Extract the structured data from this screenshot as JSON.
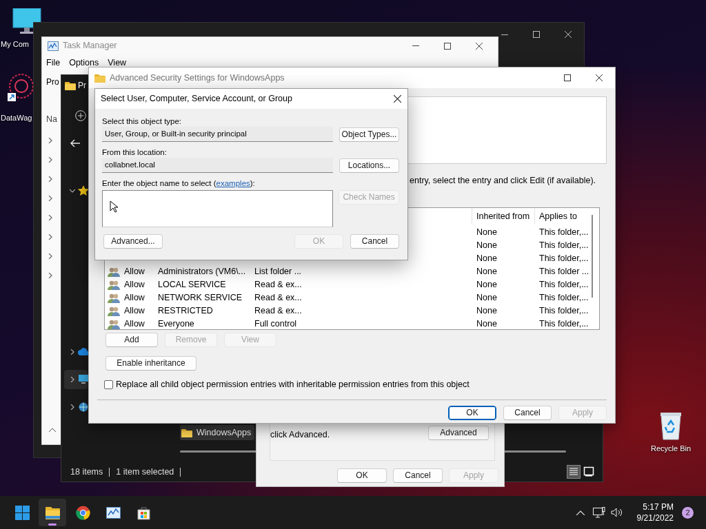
{
  "desktop_icons": [
    {
      "kind": "monitor",
      "label": "My Com"
    },
    {
      "kind": "app",
      "label": "DataWag"
    },
    {
      "kind": "bin",
      "label": "Recycle Bin"
    }
  ],
  "task_manager": {
    "title": "Task Manager",
    "menu": [
      "File",
      "Options",
      "View"
    ],
    "tab": "Pro",
    "column": "Na",
    "rows": [
      {
        "expanded": false
      },
      {
        "expanded": false
      },
      {
        "expanded": false
      },
      {
        "expanded": false
      },
      {
        "expanded": false
      },
      {
        "expanded": false
      },
      {
        "expanded": false
      },
      {
        "expanded": false
      }
    ]
  },
  "explorer": {
    "title": "Pr",
    "nav": [
      {
        "kind": "star",
        "expanded": true,
        "selected": false
      },
      {
        "kind": "cloud",
        "expanded": false,
        "selected": false
      },
      {
        "kind": "pc",
        "expanded": false,
        "selected": true
      },
      {
        "kind": "network",
        "expanded": false,
        "selected": false
      }
    ],
    "files": [
      {
        "label": "WindowsApps",
        "selected": true
      }
    ],
    "status": [
      "18 items",
      "1 item selected"
    ]
  },
  "properties": {
    "note": "click Advanced.",
    "advanced_button": "Advanced",
    "buttons": [
      {
        "label": "OK",
        "disabled": false
      },
      {
        "label": "Cancel",
        "disabled": false
      },
      {
        "label": "Apply",
        "disabled": true
      }
    ]
  },
  "advanced_security": {
    "title": "Advanced Security Settings for WindowsApps",
    "instruction": "entry, select the entry and click Edit (if available).",
    "columns": [
      "Inherited from",
      "Applies to"
    ],
    "rows": [
      {
        "inherited": "None",
        "applies": "This folder,..."
      },
      {
        "inherited": "None",
        "applies": "This folder,..."
      },
      {
        "inherited": "None",
        "applies": "This folder,..."
      },
      {
        "type": "Allow",
        "principal": "Administrators (VM6\\...",
        "access": "List folder ...",
        "inherited": "None",
        "applies": "This folder ..."
      },
      {
        "type": "Allow",
        "principal": "LOCAL SERVICE",
        "access": "Read & ex...",
        "inherited": "None",
        "applies": "This folder,..."
      },
      {
        "type": "Allow",
        "principal": "NETWORK SERVICE",
        "access": "Read & ex...",
        "inherited": "None",
        "applies": "This folder,..."
      },
      {
        "type": "Allow",
        "principal": "RESTRICTED",
        "access": "Read & ex...",
        "inherited": "None",
        "applies": "This folder,..."
      },
      {
        "type": "Allow",
        "principal": "Everyone",
        "access": "Full control",
        "inherited": "None",
        "applies": "This folder,..."
      }
    ],
    "actions": [
      {
        "label": "Add",
        "disabled": false
      },
      {
        "label": "Remove",
        "disabled": true
      },
      {
        "label": "View",
        "disabled": true
      }
    ],
    "enable_inheritance": "Enable inheritance",
    "replace_checkbox": {
      "label": "Replace all child object permission entries with inheritable permission entries from this object",
      "checked": false
    },
    "buttons": [
      {
        "label": "OK",
        "disabled": false,
        "default": true
      },
      {
        "label": "Cancel",
        "disabled": false,
        "default": false
      },
      {
        "label": "Apply",
        "disabled": true,
        "default": false
      }
    ]
  },
  "select_dialog": {
    "title": "Select User, Computer, Service Account, or Group",
    "object_type_label": "Select this object type:",
    "object_type": "User, Group, or Built-in security principal",
    "object_types_button": "Object Types...",
    "location_label": "From this location:",
    "location": "collabnet.local",
    "locations_button": "Locations...",
    "name_label": "Enter the object name to select (",
    "examples_link": "examples",
    "name_label_end": "):",
    "check_names": {
      "label": "Check Names",
      "disabled": true
    },
    "advanced_button": "Advanced...",
    "buttons": [
      {
        "label": "OK",
        "disabled": true
      },
      {
        "label": "Cancel",
        "disabled": false
      }
    ]
  },
  "taskbar": {
    "apps": [
      {
        "kind": "start",
        "active": false
      },
      {
        "kind": "folder",
        "active": true
      },
      {
        "kind": "browser",
        "active": false
      },
      {
        "kind": "chart",
        "active": false
      },
      {
        "kind": "store",
        "active": false
      }
    ],
    "time": "5:17 PM",
    "date": "9/21/2022",
    "notifications": "2"
  }
}
